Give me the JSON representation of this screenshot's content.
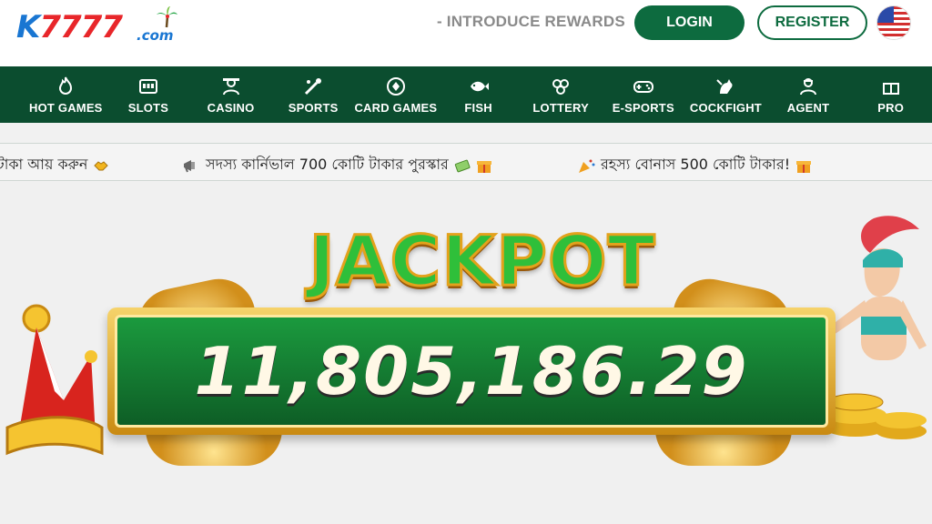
{
  "header": {
    "logo_k": "K",
    "logo_digits": "7777",
    "logo_domain": ".com",
    "introduce": "- INTRODUCE REWARDS",
    "login_label": "LOGIN",
    "register_label": "REGISTER",
    "language_icon": "us-flag-icon"
  },
  "nav": {
    "items": [
      {
        "label": "HOT GAMES",
        "icon": "flame-icon"
      },
      {
        "label": "SLOTS",
        "icon": "slot-machine-icon"
      },
      {
        "label": "CASINO",
        "icon": "casino-dealer-icon"
      },
      {
        "label": "SPORTS",
        "icon": "sports-icon"
      },
      {
        "label": "CARD GAMES",
        "icon": "poker-chip-icon"
      },
      {
        "label": "FISH",
        "icon": "fish-icon"
      },
      {
        "label": "LOTTERY",
        "icon": "lottery-balls-icon"
      },
      {
        "label": "E-SPORTS",
        "icon": "gamepad-icon"
      },
      {
        "label": "COCKFIGHT",
        "icon": "rooster-icon"
      },
      {
        "label": "AGENT",
        "icon": "agent-icon"
      },
      {
        "label": "PRO",
        "icon": "promo-icon"
      }
    ]
  },
  "marquee": {
    "items": [
      {
        "text": "টাকা আয় করুন",
        "icon": "handshake-icon"
      },
      {
        "text": "সদস্য কার্নিভাল 700 কোটি টাকার পুরস্কার",
        "icon": "megaphone-icon"
      },
      {
        "text": "রহস্য বোনাস 500 কোটি টাকার!",
        "icon": "party-popper-icon"
      }
    ]
  },
  "banner": {
    "title": "JACKPOT",
    "amount": "11,805,186.29"
  },
  "colors": {
    "brand_green": "#0d6b3f",
    "nav_bg": "#0b4d2f",
    "logo_blue": "#1976d2",
    "logo_red": "#e8262a"
  }
}
